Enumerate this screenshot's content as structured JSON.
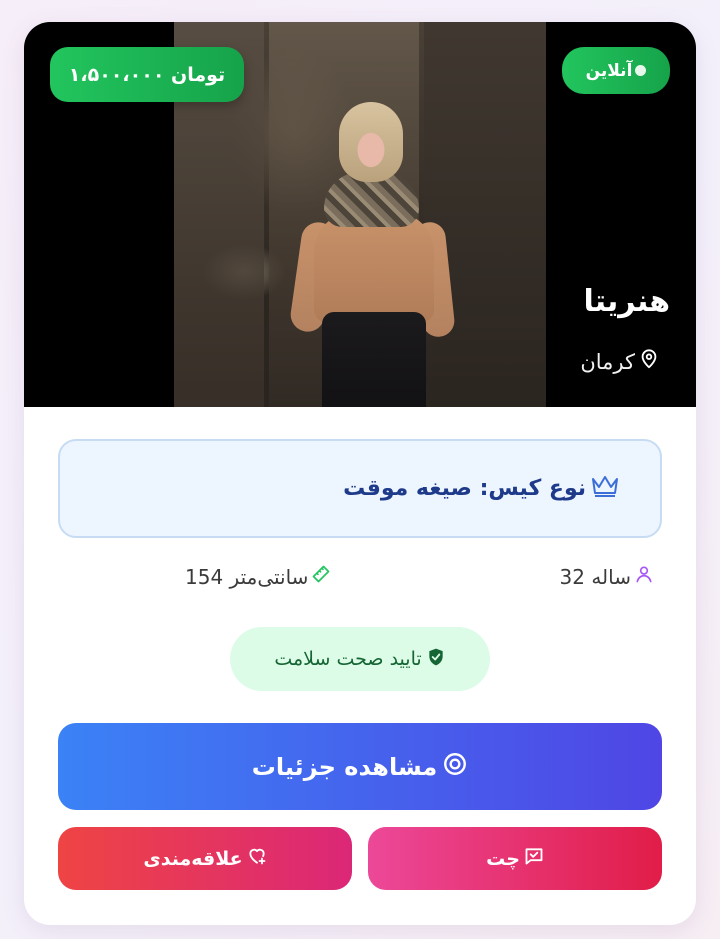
{
  "profile": {
    "price": "۱،۵۰۰،۰۰۰ تومان",
    "status": "آنلاین",
    "name": "هنریتا",
    "city": "کرمان",
    "photo_icon": "profile-photo"
  },
  "case_type": {
    "label": "نوع کیس: صیغه موقت",
    "icon": "crown-icon"
  },
  "stats": {
    "age": "32 ساله",
    "height": "154 سانتی‌متر"
  },
  "health": {
    "label": "تایید صحت سلامت",
    "icon": "shield-check-icon"
  },
  "actions": {
    "details_label": "مشاهده جزئیات",
    "chat_label": "چت",
    "favorite_label": "علاقه‌مندی"
  },
  "colors": {
    "online": "#22c55e",
    "case_text": "#1e3a8a",
    "health_bg": "#dcfce7",
    "details_from": "#3b82f6",
    "details_to": "#4f46e5",
    "chat": "#ec4899",
    "favorite": "#ef4444"
  }
}
